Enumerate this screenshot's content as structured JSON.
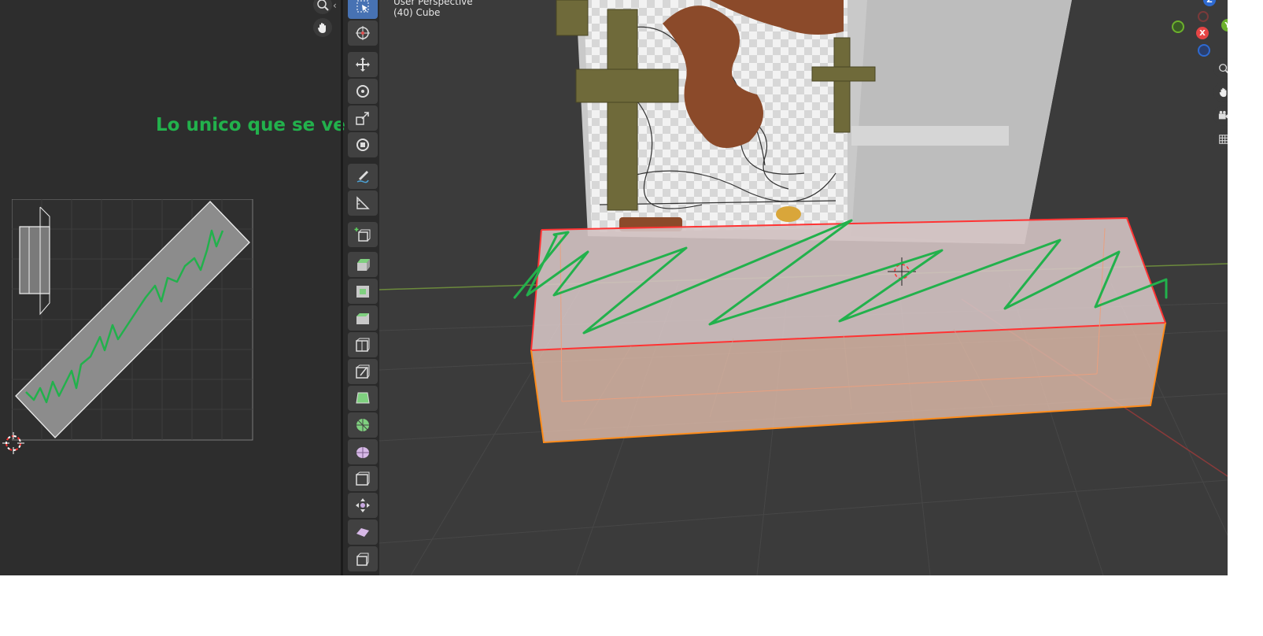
{
  "uv_editor": {
    "annotation": "Lo unico que se ve",
    "annotation_color": "#22b14c"
  },
  "viewport": {
    "title": "User Perspective",
    "object_label": "(40) Cube"
  },
  "gizmo": {
    "z_label": "Z",
    "x_label": "X",
    "y_label": "Y"
  },
  "toolbar": {
    "tools": [
      "select-box",
      "cursor",
      "move",
      "rotate",
      "scale",
      "transform",
      "annotate",
      "measure",
      "add-cube",
      "extrude-region",
      "inset-faces",
      "bevel",
      "loop-cut",
      "knife",
      "poly-build",
      "spin",
      "smooth",
      "edge-slide",
      "shrink-fatten",
      "shear",
      "rip-region"
    ]
  },
  "colors": {
    "accent": "#4772b3",
    "annotation_green": "#22b14c",
    "selection_orange": "#ff8c1a",
    "selection_red": "#ff3333"
  }
}
